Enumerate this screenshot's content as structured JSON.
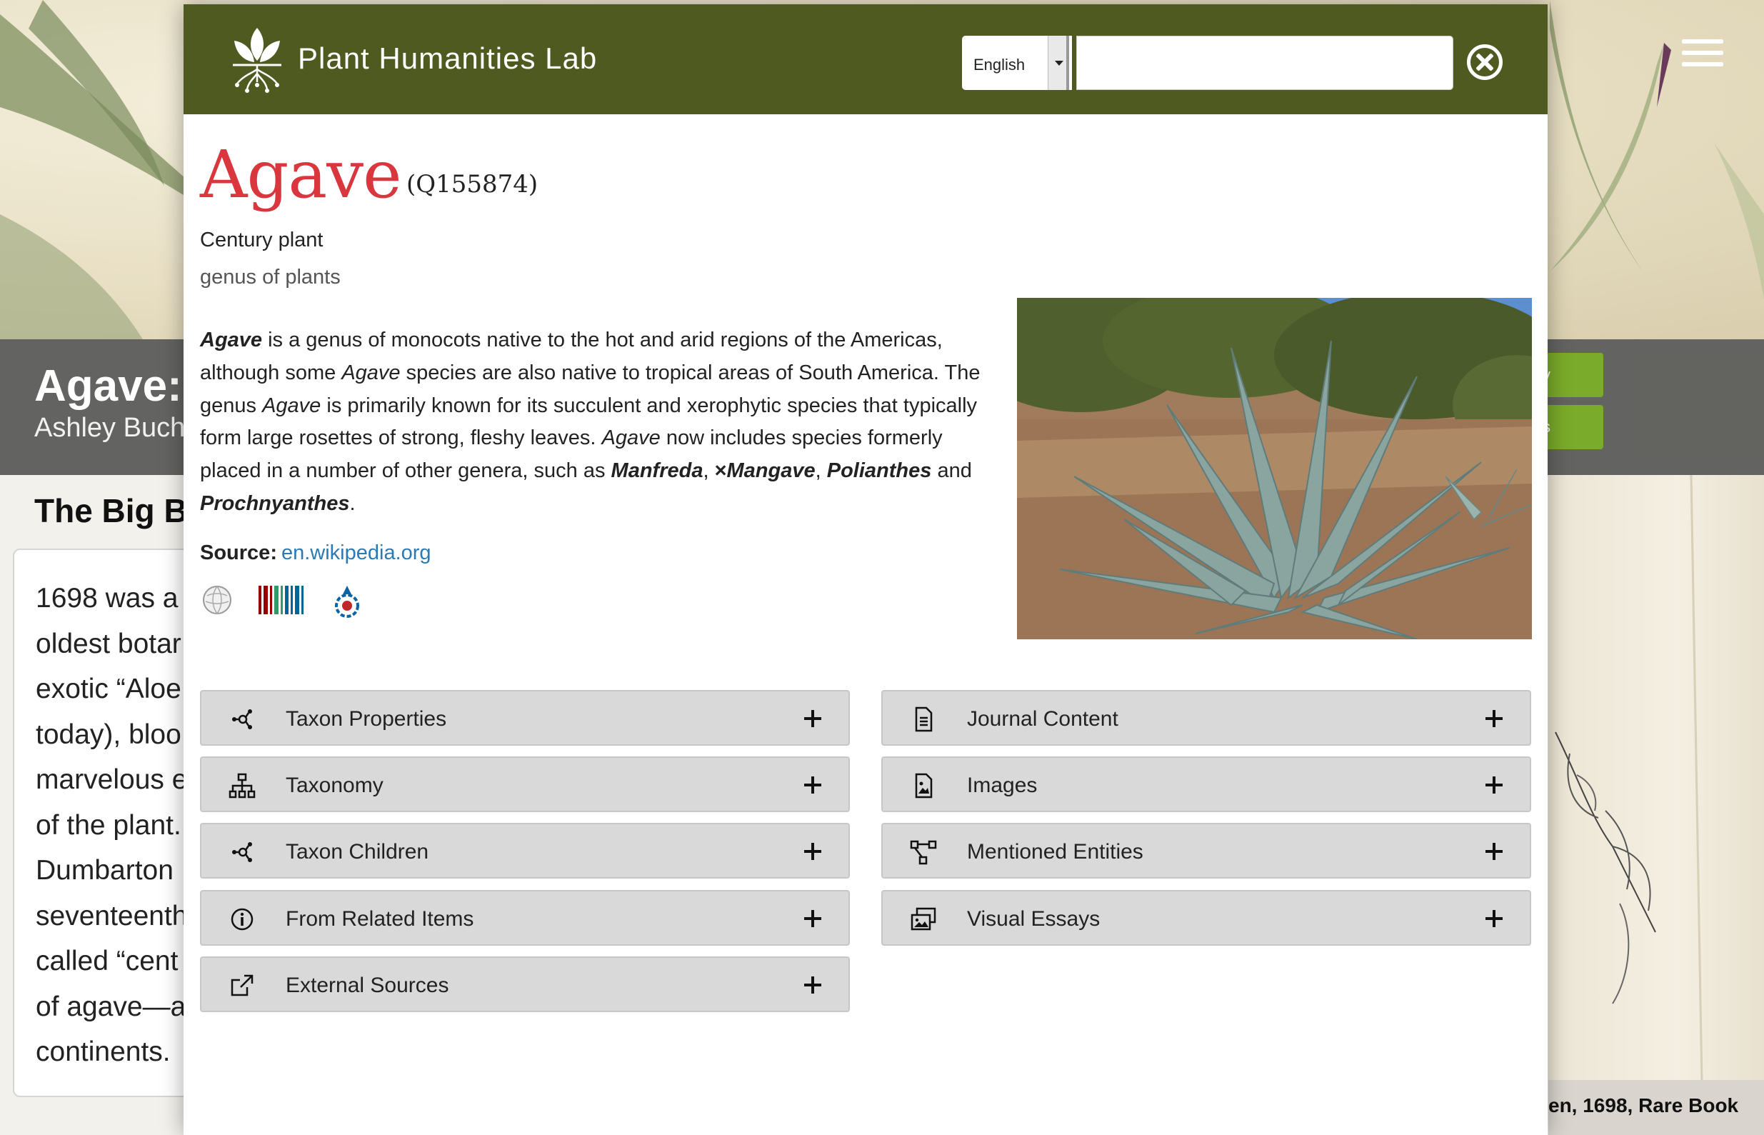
{
  "background_page": {
    "article_title": "Agave: A",
    "author": "Ashley Buch",
    "section_heading": "The Big Bl",
    "body_lines": [
      "1698 was a",
      "oldest botar",
      "exotic “Aloe",
      "today), bloo",
      "marvelous e",
      "of the plant.",
      "Dumbarton",
      "seventeenth",
      "called “cent",
      "of agave—a",
      "continents."
    ],
    "green_buttons": [
      "y",
      "s"
    ],
    "image_caption": "en, 1698, Rare Book"
  },
  "header": {
    "site_name": "Plant Humanities Lab",
    "language": "English",
    "search_value": "",
    "search_placeholder": ""
  },
  "entity": {
    "title": "Agave",
    "qid": "(Q155874)",
    "label": "Century plant",
    "description": "genus of plants",
    "source_label": "Source:",
    "source_link": "en.wikipedia.org"
  },
  "external_icons": [
    "wikipedia-icon",
    "wikidata-icon",
    "wikimedia-commons-icon"
  ],
  "accordions_left": [
    {
      "label": "Taxon Properties",
      "icon": "network-icon"
    },
    {
      "label": "Taxonomy",
      "icon": "hierarchy-icon"
    },
    {
      "label": "Taxon Children",
      "icon": "network-icon"
    },
    {
      "label": "From Related Items",
      "icon": "info-icon"
    },
    {
      "label": "External Sources",
      "icon": "external-link-icon"
    }
  ],
  "accordions_right": [
    {
      "label": "Journal Content",
      "icon": "document-icon"
    },
    {
      "label": "Images",
      "icon": "image-file-icon"
    },
    {
      "label": "Mentioned Entities",
      "icon": "diagram-icon"
    },
    {
      "label": "Visual Essays",
      "icon": "photo-stack-icon"
    }
  ],
  "colors": {
    "header_bg": "#4f5a21",
    "title_red": "#d9363e",
    "link_blue": "#2a7ab6",
    "accordion_bg": "#d9d9d9",
    "green_button": "#7aab2a"
  }
}
